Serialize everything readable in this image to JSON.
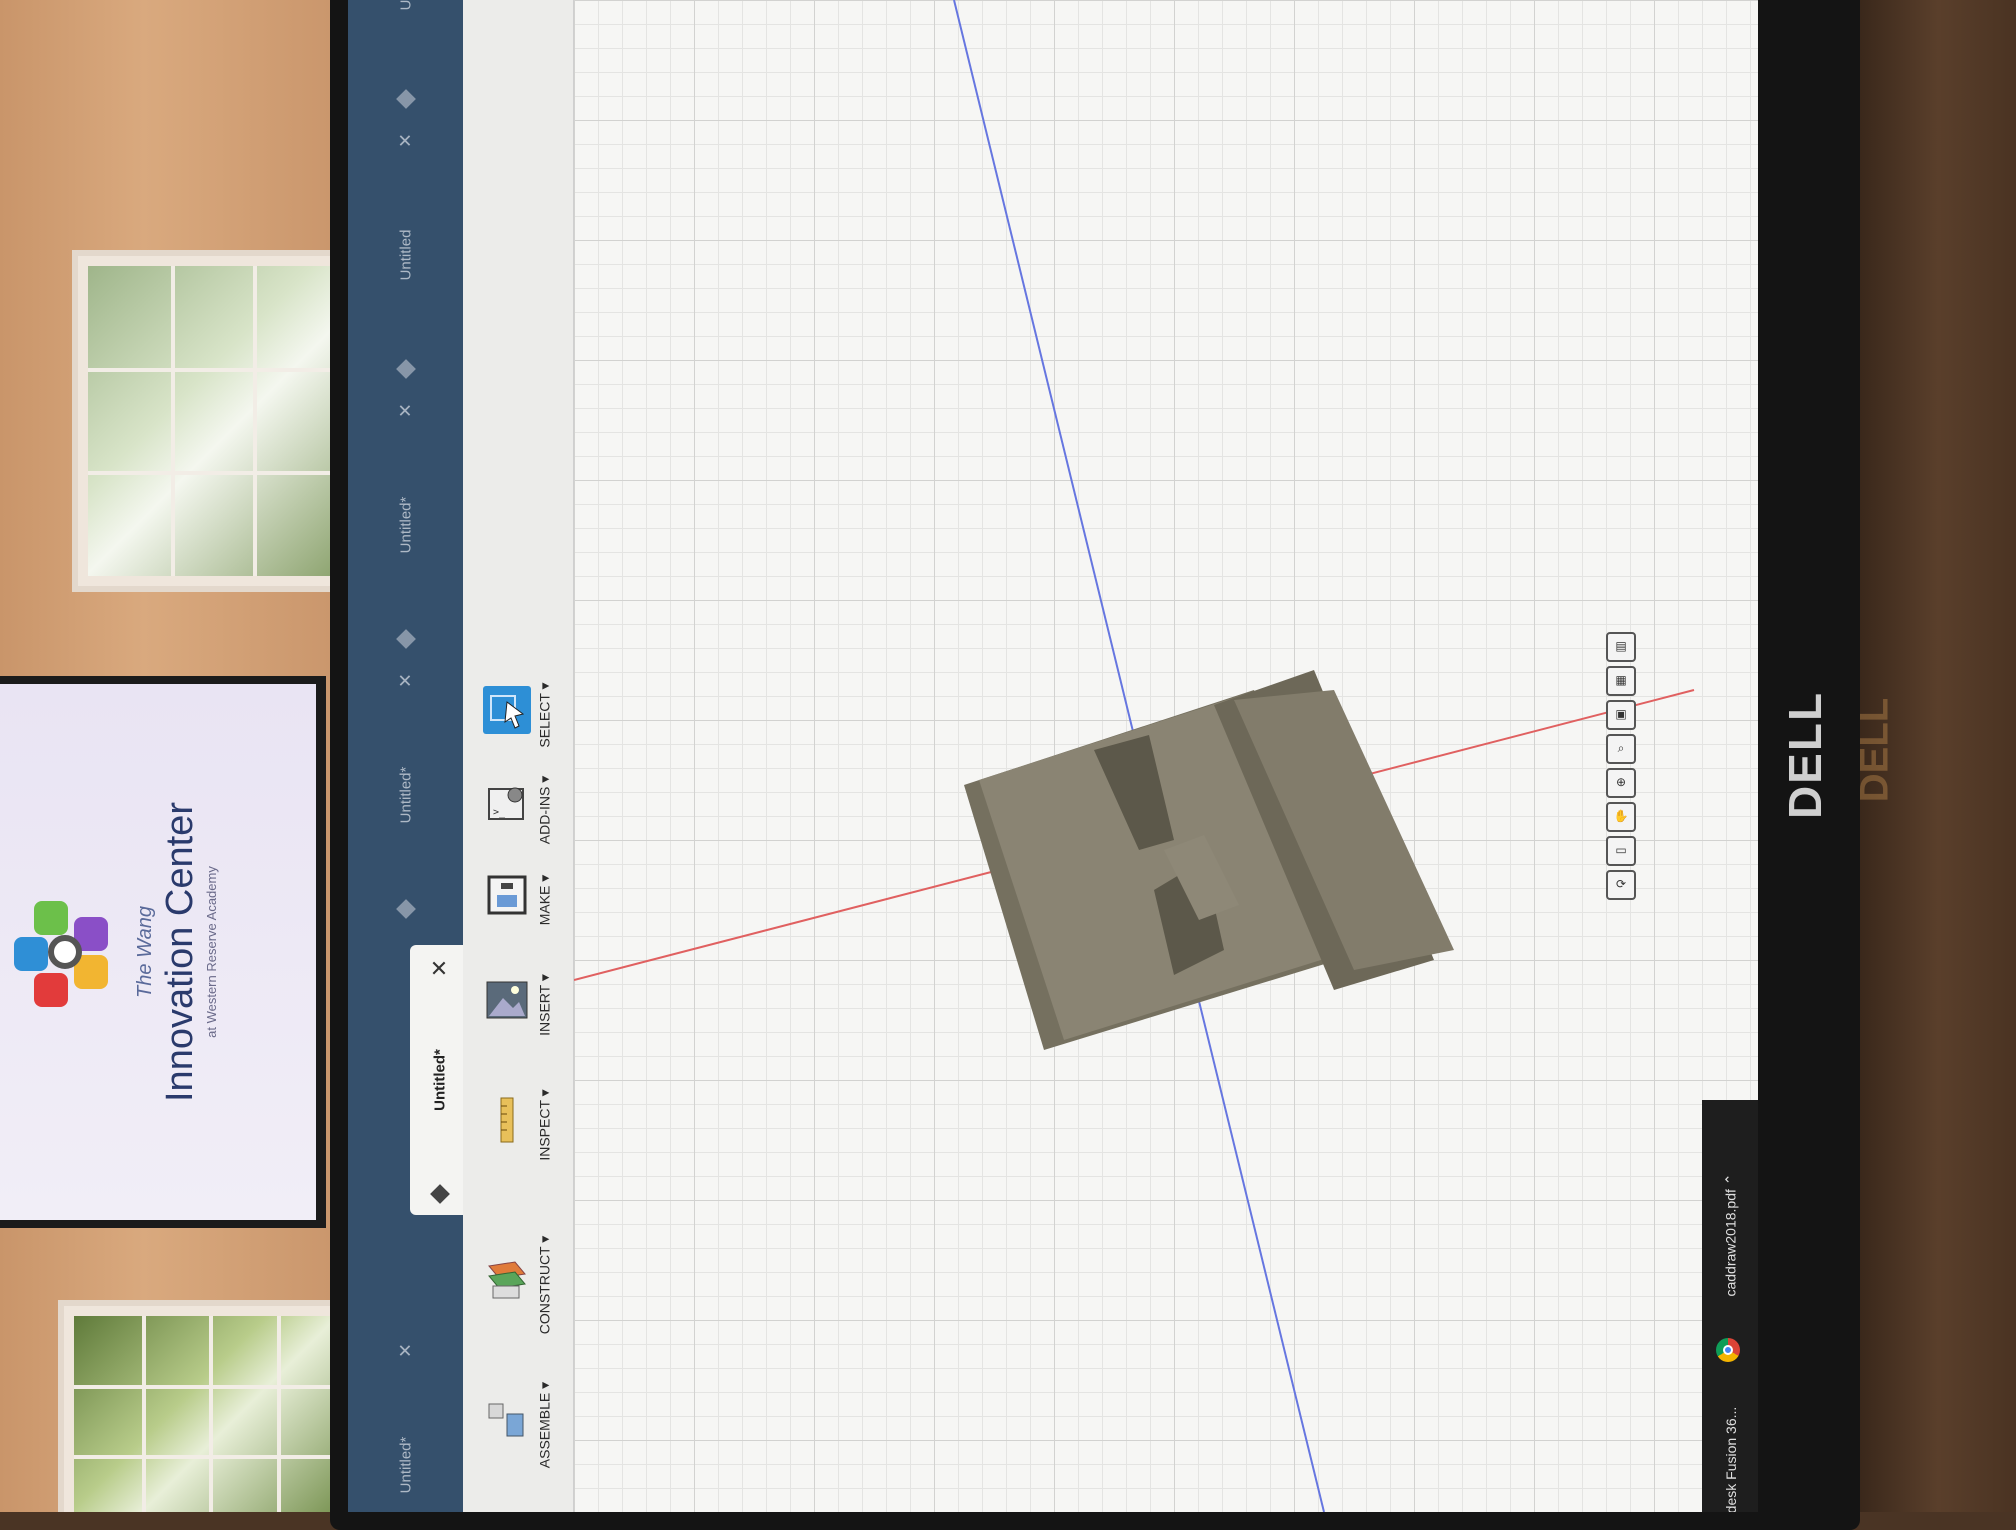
{
  "tv": {
    "line1": "The Wang",
    "line2": "Innovation Center",
    "line3": "at Western Reserve Academy"
  },
  "monitor": {
    "brand": "DELL"
  },
  "tabs": [
    {
      "label": "Untitled*",
      "active": false
    },
    {
      "label": "Untitled*",
      "active": true
    },
    {
      "label": "Untitled*",
      "active": false
    },
    {
      "label": "Untitled*",
      "active": false
    },
    {
      "label": "Untitled",
      "active": false
    },
    {
      "label": "Untitled",
      "active": false
    }
  ],
  "toolbar": [
    {
      "label": "ASSEMBLE ▾",
      "icon": "assemble-icon"
    },
    {
      "label": "CONSTRUCT ▾",
      "icon": "construct-icon"
    },
    {
      "label": "INSPECT ▾",
      "icon": "ruler-icon"
    },
    {
      "label": "INSERT ▾",
      "icon": "image-icon"
    },
    {
      "label": "MAKE ▾",
      "icon": "3d-print-icon"
    },
    {
      "label": "ADD-INS ▾",
      "icon": "add-ins-gear-icon"
    },
    {
      "label": "SELECT ▾",
      "icon": "select-cursor-icon"
    }
  ],
  "nav_tools": [
    "orbit-icon",
    "look-at-icon",
    "pan-hand-icon",
    "zoom-icon",
    "fit-icon",
    "display-settings-icon",
    "grid-icon",
    "viewports-icon"
  ],
  "taskbar": [
    {
      "label": "caddraw2018.pdf ⌃",
      "icon": "chrome-icon"
    },
    {
      "label": "desk Fusion 36...",
      "icon": "fusion-icon"
    }
  ],
  "colors": {
    "tab_bar": "#35506c",
    "model_face": "#8a8473",
    "axis_red": "#e05a5a",
    "axis_blue": "#5a6fe0"
  }
}
